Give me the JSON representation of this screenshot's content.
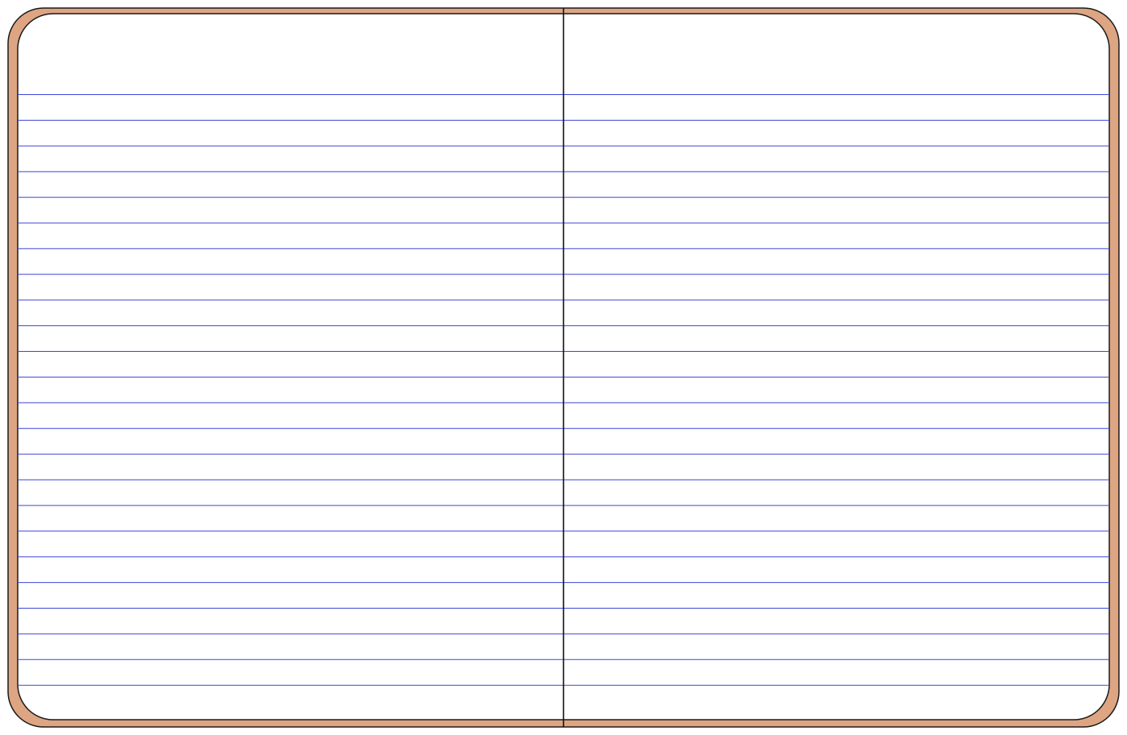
{
  "notebook": {
    "cover_color": "#dea583",
    "outline_color": "#1a1a1a",
    "page_color": "#ffffff",
    "rule_color": "#3b45d6",
    "spine_color": "#111111",
    "pages": [
      "left-page",
      "right-page"
    ],
    "ruled_lines_per_page": 24
  }
}
